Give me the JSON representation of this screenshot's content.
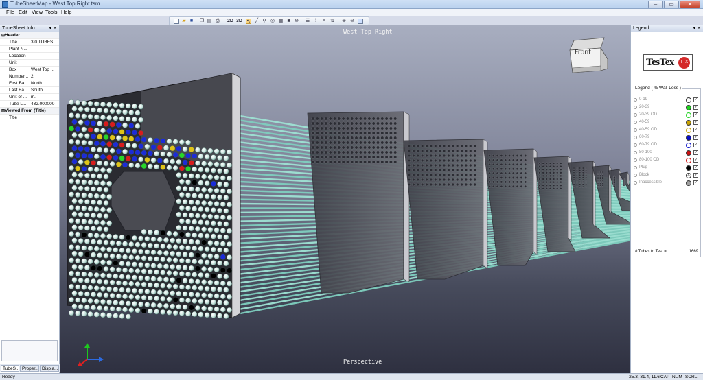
{
  "window": {
    "title": "TubeSheetMap - West Top Right.tsm",
    "min_label": "–",
    "max_label": "▭",
    "close_label": "✕"
  },
  "menu": [
    "File",
    "Edit",
    "View",
    "Tools",
    "Help"
  ],
  "toolbar": {
    "icons": [
      "new-icon",
      "open-icon",
      "save-icon",
      "copy-icon",
      "paste-icon",
      "print-icon",
      "2d-view",
      "3d-view",
      "pointer-icon",
      "tube-icon",
      "pin-icon",
      "target-icon",
      "grid-icon",
      "camera-icon",
      "zoom-icon",
      "row-icon",
      "column-icon",
      "align-icon",
      "sort-icon",
      "zoom-in-icon",
      "zoom-out-icon",
      "zoom-fit-icon"
    ],
    "label_2d": "2D",
    "label_3d": "3D"
  },
  "left_panel": {
    "title": "TubeSheet Info",
    "pin": "▾ ✕",
    "rows": [
      {
        "type": "section",
        "key": "Header",
        "exp": "⊟"
      },
      {
        "type": "row",
        "key": "Title",
        "value": "3.0 TUBES..."
      },
      {
        "type": "row",
        "key": "Plant N...",
        "value": ""
      },
      {
        "type": "row",
        "key": "Location",
        "value": ""
      },
      {
        "type": "row",
        "key": "Unit",
        "value": ""
      },
      {
        "type": "row",
        "key": "Box",
        "value": "West Top ..."
      },
      {
        "type": "row",
        "key": "Number...",
        "value": "2"
      },
      {
        "type": "row",
        "key": "First Ba...",
        "value": "North"
      },
      {
        "type": "row",
        "key": "Last Ba...",
        "value": "South"
      },
      {
        "type": "row",
        "key": "Unit of ...",
        "value": "in."
      },
      {
        "type": "row",
        "key": "Tube L...",
        "value": "432.000000"
      },
      {
        "type": "section",
        "key": "Viewed From (Title)",
        "exp": "⊟"
      },
      {
        "type": "row",
        "key": "Title",
        "value": ""
      }
    ],
    "tabs": [
      "TubeS...",
      "Proper...",
      "Displa..."
    ]
  },
  "viewport": {
    "top_label": "West Top Right",
    "bottom_label": "Perspective",
    "cube_label": "Front"
  },
  "legend": {
    "panel_title": "Legend",
    "pin": "▾ ✕",
    "logo_text": "TesTex",
    "logo_badge": "TTX",
    "group_title": "Legend ( % Wall Loss )",
    "items": [
      {
        "label": "0-19",
        "color": "#ffffff",
        "style": "solid",
        "checked": true
      },
      {
        "label": "20-39",
        "color": "#1fd21f",
        "style": "solid",
        "checked": true
      },
      {
        "label": "20-39 OD",
        "color": "#1fd21f",
        "style": "ring",
        "checked": true
      },
      {
        "label": "40-59",
        "color": "#c8a200",
        "style": "solid",
        "checked": true
      },
      {
        "label": "40-59 OD",
        "color": "#c8a200",
        "style": "ring",
        "checked": true
      },
      {
        "label": "60-79",
        "color": "#0a10c8",
        "style": "solid",
        "checked": true
      },
      {
        "label": "60-79 OD",
        "color": "#0a10c8",
        "style": "ring",
        "checked": true
      },
      {
        "label": "80-100",
        "color": "#d01010",
        "style": "solid",
        "checked": true
      },
      {
        "label": "80-100 OD",
        "color": "#d01010",
        "style": "ring",
        "checked": true
      },
      {
        "label": "Plug",
        "color": "#000000",
        "style": "solid",
        "checked": true
      },
      {
        "label": "Block",
        "color": "#ffffff",
        "style": "cross",
        "checked": true
      },
      {
        "label": "Inaccessible",
        "color": "#a0a0a0",
        "style": "solid",
        "checked": true
      }
    ],
    "tubes_label": "# Tubes to Test =",
    "tubes_count": "1669"
  },
  "status": {
    "ready": "Ready",
    "coords": "-25.3, 31.4, 11.6",
    "cap": "CAP",
    "num": "NUM",
    "scrl": "SCRL"
  }
}
